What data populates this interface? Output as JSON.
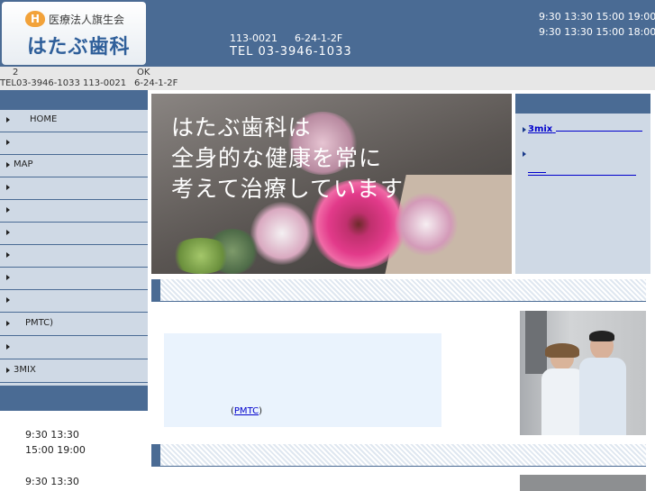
{
  "header": {
    "logo_mark": "H",
    "org_name": "医療法人旗生会",
    "clinic_name": "はたぶ歯科",
    "postal": "113-0021",
    "address": "6-24-1-2F",
    "tel": "TEL 03-3946-1033",
    "hours_line1": "9:30 13:30 15:00 19:00",
    "hours_line2": "9:30 13:30 15:00 18:00"
  },
  "notice": {
    "a": "2",
    "b": "OK",
    "tel": "TEL03-3946-1033 113-0021",
    "addr": "6-24-1-2F"
  },
  "sidebar": {
    "items": [
      {
        "label": "HOME"
      },
      {
        "label": ""
      },
      {
        "label": "MAP"
      },
      {
        "label": ""
      },
      {
        "label": ""
      },
      {
        "label": ""
      },
      {
        "label": ""
      },
      {
        "label": ""
      },
      {
        "label": ""
      },
      {
        "label": "PMTC)"
      },
      {
        "label": ""
      },
      {
        "label": "3MIX"
      }
    ],
    "hours": [
      "9:30 13:30",
      "15:00 19:00",
      "9:30 13:30"
    ]
  },
  "hero": {
    "lines": [
      "はたぶ歯科は",
      "全身的な健康を常に",
      "考えて治療しています"
    ]
  },
  "right_panel": {
    "link1": "3mix"
  },
  "content": {
    "pmtc_link": "PMTC",
    "pmtc_open": "(",
    "pmtc_close": ")"
  },
  "colors": {
    "header": "#4a6b94",
    "sidebar": "#cfd9e5",
    "link": "#0000cc",
    "info_box": "#eaf3fd"
  }
}
